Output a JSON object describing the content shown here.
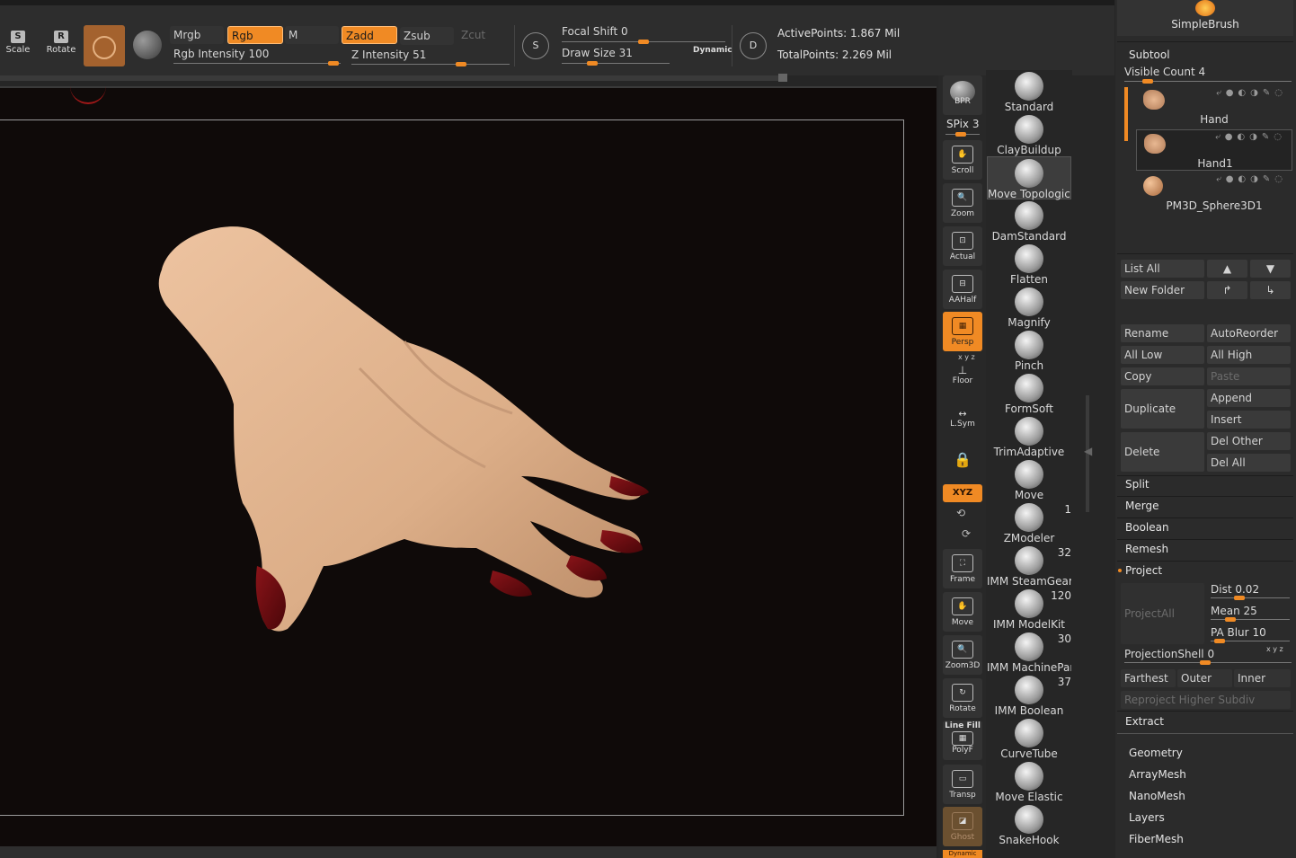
{
  "toolbar": {
    "scale_label": "Scale",
    "rotate_label": "Rotate",
    "mrgb": "Mrgb",
    "rgb": "Rgb",
    "m": "M",
    "zadd": "Zadd",
    "zsub": "Zsub",
    "zcut": "Zcut",
    "rgb_intensity_label": "Rgb Intensity",
    "rgb_intensity_value": "100",
    "z_intensity_label": "Z Intensity",
    "z_intensity_value": "51",
    "focal_shift_label": "Focal Shift",
    "focal_shift_value": "0",
    "draw_size_label": "Draw Size",
    "draw_size_value": "31",
    "dynamic_label": "Dynamic",
    "s_label": "S",
    "d_label": "D",
    "active_points": "ActivePoints: 1.867 Mil",
    "total_points": "TotalPoints: 2.269 Mil"
  },
  "shelf": {
    "bpr": "BPR",
    "spix": "SPix 3",
    "scroll": "Scroll",
    "zoom": "Zoom",
    "actual": "Actual",
    "aahalf": "AAHalf",
    "persp": "Persp",
    "xyz_small": "x y z",
    "floor": "Floor",
    "lsym": "L.Sym",
    "xyz": "XYZ",
    "frame": "Frame",
    "move": "Move",
    "zoom3d": "Zoom3D",
    "rotate": "Rotate",
    "linefill": "Line Fill",
    "polyf": "PolyF",
    "transp": "Transp",
    "ghost": "Ghost",
    "dynamic": "Dynamic"
  },
  "brushes": [
    {
      "name": "Standard",
      "count": ""
    },
    {
      "name": "ClayBuildup",
      "count": ""
    },
    {
      "name": "Move Topological",
      "count": ""
    },
    {
      "name": "DamStandard",
      "count": ""
    },
    {
      "name": "Flatten",
      "count": ""
    },
    {
      "name": "Magnify",
      "count": ""
    },
    {
      "name": "Pinch",
      "count": ""
    },
    {
      "name": "FormSoft",
      "count": ""
    },
    {
      "name": "TrimAdaptive",
      "count": ""
    },
    {
      "name": "Move",
      "count": ""
    },
    {
      "name": "ZModeler",
      "count": "1"
    },
    {
      "name": "IMM SteamGear",
      "count": "32"
    },
    {
      "name": "IMM ModelKit",
      "count": "120"
    },
    {
      "name": "IMM MachinePart",
      "count": "30"
    },
    {
      "name": "IMM Boolean",
      "count": "37"
    },
    {
      "name": "CurveTube",
      "count": ""
    },
    {
      "name": "Move Elastic",
      "count": ""
    },
    {
      "name": "SnakeHook",
      "count": ""
    }
  ],
  "panel": {
    "simplebrush": "SimpleBrush",
    "subtool_title": "Subtool",
    "visible_count": "Visible Count 4",
    "items": [
      {
        "name": "Hand"
      },
      {
        "name": "Hand1"
      },
      {
        "name": "PM3D_Sphere3D1"
      }
    ],
    "list_all": "List All",
    "new_folder": "New Folder",
    "rename": "Rename",
    "autoreorder": "AutoReorder",
    "all_low": "All Low",
    "all_high": "All High",
    "copy": "Copy",
    "paste": "Paste",
    "duplicate": "Duplicate",
    "append": "Append",
    "insert": "Insert",
    "delete": "Delete",
    "del_other": "Del Other",
    "del_all": "Del All",
    "split": "Split",
    "merge": "Merge",
    "boolean": "Boolean",
    "remesh": "Remesh",
    "project": "Project",
    "projectall": "ProjectAll",
    "dist_label": "Dist",
    "dist_value": "0.02",
    "mean_label": "Mean",
    "mean_value": "25",
    "pablur_label": "PA Blur",
    "pablur_value": "10",
    "projectionshell_label": "ProjectionShell",
    "projectionshell_value": "0",
    "xyz_small": "x y z",
    "farthest": "Farthest",
    "outer": "Outer",
    "inner": "Inner",
    "reproject": "Reproject Higher Subdiv",
    "extract": "Extract",
    "sections": [
      "Geometry",
      "ArrayMesh",
      "NanoMesh",
      "Layers",
      "FiberMesh"
    ]
  },
  "colors": {
    "accent": "#f08a24",
    "skin": "#e2b48e",
    "nail": "#6a0d12",
    "canvas": "#0f0a09"
  }
}
